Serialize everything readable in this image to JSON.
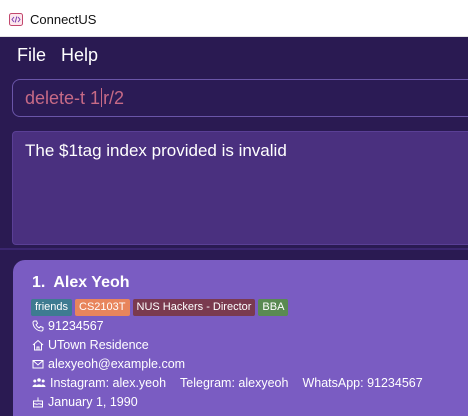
{
  "window": {
    "title": "ConnectUS"
  },
  "menu": {
    "file": "File",
    "help": "Help"
  },
  "command": {
    "before_caret": "delete-t 1",
    "after_caret": "r/2"
  },
  "result": {
    "message": "The $1tag index provided is invalid"
  },
  "person": {
    "index": "1.",
    "name": "Alex Yeoh",
    "tags": [
      {
        "label": "friends",
        "color": "#3e7b91"
      },
      {
        "label": "CS2103T",
        "color": "#e8855c"
      },
      {
        "label": "NUS Hackers - Director",
        "color": "#7a3a4f"
      },
      {
        "label": "BBA",
        "color": "#5a8a52"
      }
    ],
    "phone": "91234567",
    "address": "UTown Residence",
    "email": "alexyeoh@example.com",
    "socials": {
      "instagram": "Instagram: alex.yeoh",
      "telegram": "Telegram: alexyeoh",
      "whatsapp": "WhatsApp: 91234567"
    },
    "birthday": "January 1, 1990"
  },
  "colors": {
    "window_bg": "#2a1a52",
    "card_bg": "#7a5cc2",
    "error_text": "#c76a86"
  }
}
